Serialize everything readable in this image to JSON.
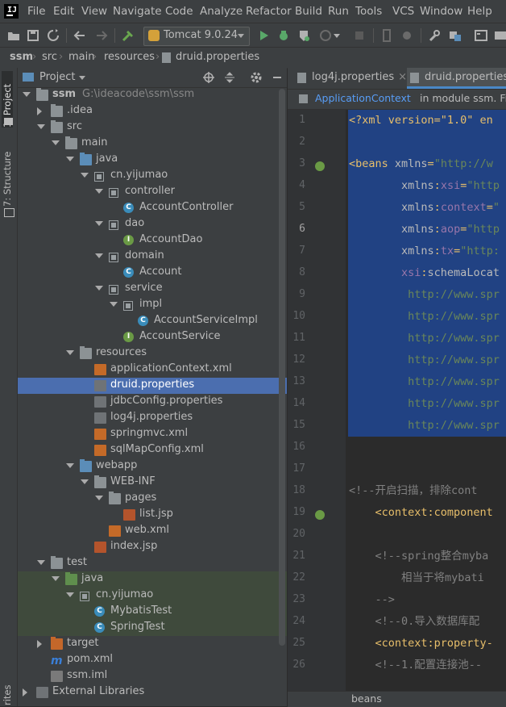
{
  "menu": [
    "File",
    "Edit",
    "View",
    "Navigate",
    "Code",
    "Analyze",
    "Refactor",
    "Build",
    "Run",
    "Tools",
    "VCS",
    "Window",
    "Help"
  ],
  "toolbar": {
    "run_config": "Tomcat 9.0.24"
  },
  "breadcrumb": [
    "ssm",
    "src",
    "main",
    "resources",
    "druid.properties"
  ],
  "left_strip": {
    "project_tab": "1: Project",
    "structure_tab": "7: Structure",
    "bottom_tab": "rites"
  },
  "project_panel": {
    "title": "Project",
    "tree": [
      {
        "label": "ssm",
        "sub": "G:\\ideacode\\ssm\\ssm",
        "icon": "module-folder-icon",
        "indent": 0,
        "expand": "down",
        "bold": true
      },
      {
        "label": ".idea",
        "icon": "folder-icon",
        "indent": 1,
        "expand": "right"
      },
      {
        "label": "src",
        "icon": "folder-icon",
        "indent": 1,
        "expand": "down"
      },
      {
        "label": "main",
        "icon": "folder-icon",
        "indent": 2,
        "expand": "down"
      },
      {
        "label": "java",
        "icon": "source-folder-icon",
        "indent": 3,
        "expand": "down"
      },
      {
        "label": "cn.yijumao",
        "icon": "package-icon",
        "indent": 4,
        "expand": "down"
      },
      {
        "label": "controller",
        "icon": "package-icon",
        "indent": 5,
        "expand": "down"
      },
      {
        "label": "AccountController",
        "icon": "class-icon",
        "indent": 6
      },
      {
        "label": "dao",
        "icon": "package-icon",
        "indent": 5,
        "expand": "down"
      },
      {
        "label": "AccountDao",
        "icon": "interface-icon",
        "indent": 6
      },
      {
        "label": "domain",
        "icon": "package-icon",
        "indent": 5,
        "expand": "down"
      },
      {
        "label": "Account",
        "icon": "class-icon",
        "indent": 6
      },
      {
        "label": "service",
        "icon": "package-icon",
        "indent": 5,
        "expand": "down"
      },
      {
        "label": "impl",
        "icon": "package-icon",
        "indent": 6,
        "expand": "down"
      },
      {
        "label": "AccountServiceImpl",
        "icon": "class-icon",
        "indent": 7
      },
      {
        "label": "AccountService",
        "icon": "interface-icon",
        "indent": 6
      },
      {
        "label": "resources",
        "icon": "resources-folder-icon",
        "indent": 3,
        "expand": "down"
      },
      {
        "label": "applicationContext.xml",
        "icon": "xml-file-icon",
        "indent": 4
      },
      {
        "label": "druid.properties",
        "icon": "properties-file-icon",
        "indent": 4,
        "selected": true
      },
      {
        "label": "jdbcConfig.properties",
        "icon": "properties-file-icon",
        "indent": 4
      },
      {
        "label": "log4j.properties",
        "icon": "properties-file-icon",
        "indent": 4
      },
      {
        "label": "springmvc.xml",
        "icon": "xml-file-icon",
        "indent": 4
      },
      {
        "label": "sqlMapConfig.xml",
        "icon": "xml-file-icon",
        "indent": 4
      },
      {
        "label": "webapp",
        "icon": "web-folder-icon",
        "indent": 3,
        "expand": "down"
      },
      {
        "label": "WEB-INF",
        "icon": "folder-icon",
        "indent": 4,
        "expand": "down"
      },
      {
        "label": "pages",
        "icon": "folder-icon",
        "indent": 5,
        "expand": "down"
      },
      {
        "label": "list.jsp",
        "icon": "jsp-file-icon",
        "indent": 6
      },
      {
        "label": "web.xml",
        "icon": "xml-file-icon",
        "indent": 5
      },
      {
        "label": "index.jsp",
        "icon": "jsp-file-icon",
        "indent": 4
      },
      {
        "label": "test",
        "icon": "folder-icon",
        "indent": 1,
        "expand": "down"
      },
      {
        "label": "java",
        "icon": "test-folder-icon",
        "indent": 2,
        "expand": "down",
        "test": true
      },
      {
        "label": "cn.yijumao",
        "icon": "package-icon",
        "indent": 3,
        "expand": "down",
        "test": true
      },
      {
        "label": "MybatisTest",
        "icon": "test-class-icon",
        "indent": 4,
        "test": true
      },
      {
        "label": "SpringTest",
        "icon": "test-class-icon",
        "indent": 4,
        "test": true
      },
      {
        "label": "target",
        "icon": "excluded-folder-icon",
        "indent": 1,
        "expand": "right"
      },
      {
        "label": "pom.xml",
        "icon": "maven-icon",
        "indent": 1
      },
      {
        "label": "ssm.iml",
        "icon": "iml-file-icon",
        "indent": 1
      },
      {
        "label": "External Libraries",
        "icon": "libraries-icon",
        "indent": 0,
        "expand": "right"
      }
    ]
  },
  "editor": {
    "tabs": [
      {
        "label": "log4j.properties",
        "active": false
      },
      {
        "label": "druid.properties",
        "active": true
      }
    ],
    "context_link": "ApplicationContext",
    "context_module": "in module ssm. File",
    "status": "beans",
    "lines": [
      {
        "n": "1",
        "parts": [
          [
            "pi",
            "<?xml version=\"1.0\" en"
          ]
        ],
        "sel": true
      },
      {
        "n": "2",
        "parts": [],
        "sel": true
      },
      {
        "n": "3",
        "parts": [
          [
            "tag",
            "<beans "
          ],
          [
            "attr",
            "xmlns"
          ],
          [
            "tag",
            "="
          ],
          [
            "str",
            "\"http://w"
          ]
        ],
        "sel": true
      },
      {
        "n": "4",
        "parts": [
          [
            "attr",
            "        xmlns"
          ],
          [
            "tag",
            ":"
          ],
          [
            "ns",
            "xsi"
          ],
          [
            "tag",
            "="
          ],
          [
            "str",
            "\"http"
          ]
        ],
        "sel": true
      },
      {
        "n": "5",
        "parts": [
          [
            "attr",
            "        xmlns"
          ],
          [
            "tag",
            ":"
          ],
          [
            "ns",
            "context"
          ],
          [
            "tag",
            "="
          ],
          [
            "str",
            "\""
          ]
        ],
        "sel": true
      },
      {
        "n": "6",
        "parts": [
          [
            "attr",
            "        xmlns"
          ],
          [
            "tag",
            ":"
          ],
          [
            "ns",
            "aop"
          ],
          [
            "tag",
            "="
          ],
          [
            "str",
            "\"http"
          ]
        ],
        "sel": true
      },
      {
        "n": "7",
        "parts": [
          [
            "attr",
            "        xmlns"
          ],
          [
            "tag",
            ":"
          ],
          [
            "ns",
            "tx"
          ],
          [
            "tag",
            "="
          ],
          [
            "str",
            "\"http:"
          ]
        ],
        "sel": true
      },
      {
        "n": "8",
        "parts": [
          [
            "ns",
            "        xsi"
          ],
          [
            "tag",
            ":"
          ],
          [
            "attr",
            "schemaLocat"
          ]
        ],
        "sel": true
      },
      {
        "n": "9",
        "parts": [
          [
            "url",
            "         http://www.spr"
          ]
        ],
        "sel": true
      },
      {
        "n": "10",
        "parts": [
          [
            "url",
            "         http://www.spr"
          ]
        ],
        "sel": true
      },
      {
        "n": "11",
        "parts": [
          [
            "url",
            "         http://www.spr"
          ]
        ],
        "sel": true
      },
      {
        "n": "12",
        "parts": [
          [
            "url",
            "         http://www.spr"
          ]
        ],
        "sel": true
      },
      {
        "n": "13",
        "parts": [
          [
            "url",
            "         http://www.spr"
          ]
        ],
        "sel": true
      },
      {
        "n": "14",
        "parts": [
          [
            "url",
            "         http://www.spr"
          ]
        ],
        "sel": true
      },
      {
        "n": "15",
        "parts": [
          [
            "url",
            "         http://www.spr"
          ]
        ],
        "sel": true
      },
      {
        "n": "16",
        "parts": []
      },
      {
        "n": "17",
        "parts": []
      },
      {
        "n": "18",
        "parts": [
          [
            "cmt",
            "<!--开启扫描，排除cont"
          ]
        ]
      },
      {
        "n": "19",
        "parts": [
          [
            "tag",
            "    <context:component"
          ]
        ]
      },
      {
        "n": "20",
        "parts": []
      },
      {
        "n": "21",
        "parts": [
          [
            "cmt",
            "    <!--spring整合myba"
          ]
        ]
      },
      {
        "n": "22",
        "parts": [
          [
            "cmt",
            "        相当于将mybati"
          ]
        ]
      },
      {
        "n": "23",
        "parts": [
          [
            "cmt",
            "    -->"
          ]
        ]
      },
      {
        "n": "24",
        "parts": [
          [
            "cmt",
            "    <!--0.导入数据库配"
          ]
        ]
      },
      {
        "n": "25",
        "parts": [
          [
            "tag",
            "    <context:property-"
          ]
        ]
      },
      {
        "n": "26",
        "parts": [
          [
            "cmt",
            "    <!--1.配置连接池--"
          ]
        ]
      }
    ]
  }
}
